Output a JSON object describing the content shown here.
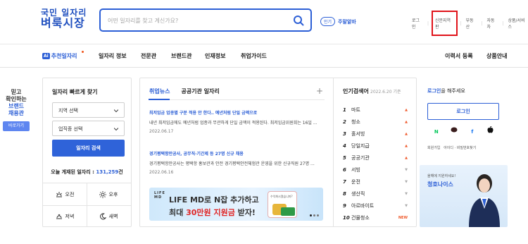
{
  "header": {
    "logo_line1": "국민 일자리",
    "logo_line2": "벼룩시장",
    "search_placeholder": "어떤 일자리를 찾고 계신가요?",
    "popular_pill": "인기",
    "popular_word": "주말알바",
    "util_links": [
      "로그인",
      "신문지역판",
      "부동산",
      "자동차",
      "상품/서비스"
    ]
  },
  "nav": {
    "ai_badge": "Ai",
    "ai_label": "추천일자리",
    "items": [
      "일자리 정보",
      "전문관",
      "브랜드관",
      "인재정보",
      "취업가이드"
    ],
    "right_items": [
      "이력서 등록",
      "상품안내"
    ]
  },
  "quick": {
    "line1": "믿고",
    "line2": "확인하는",
    "line3": "브랜드",
    "line4": "채용관",
    "button": "바로가기"
  },
  "job_search": {
    "title": "일자리 빠르게 찾기",
    "region_select": "지역 선택",
    "job_select": "업직종 선택",
    "search_button": "일자리 검색",
    "count_label": "오늘 게재된 일자리 :",
    "count_value": "131,259",
    "count_unit": "건",
    "times": [
      "오전",
      "오후",
      "저녁",
      "새벽"
    ]
  },
  "news": {
    "tabs": [
      "취업뉴스",
      "공공기관 일자리"
    ],
    "plus": "+",
    "items": [
      {
        "title": "최저임금 업종별 구분 적용 안 한다‥ 예년처럼 단일 금액으로",
        "body": "내년 최저임금에도 예년처럼 업종과 무관하게 단일 금액이 적용된다. 최저임금위원회는 16일 ...",
        "date": "2022.06.17"
      },
      {
        "title": "경기평택항만공사, 공무직·기간제 등 27명 신규 채용",
        "body": "경기평택항만공사는 평택항 홍보관과 안전 경기평택안전체험관 운영을 위한 신규직원 27명 ...",
        "date": "2022.06.16"
      }
    ],
    "ad": {
      "brand1": "LIFE",
      "brand2": "MD",
      "line1": "LIFE MD로 N잡 추가하고",
      "line2_pre": "최대 ",
      "line2_red": "30만원 지원금",
      "line2_post": " 받자!",
      "phone_text": "수익화시켰습니까?"
    }
  },
  "keywords": {
    "title": "인기검색어",
    "date": "2022.6.20 기준",
    "items": [
      {
        "rank": "1",
        "word": "마트",
        "trend": "up"
      },
      {
        "rank": "2",
        "word": "청소",
        "trend": "up"
      },
      {
        "rank": "3",
        "word": "홀서빙",
        "trend": "up"
      },
      {
        "rank": "4",
        "word": "당일지급",
        "trend": "up"
      },
      {
        "rank": "5",
        "word": "공공기관",
        "trend": "up"
      },
      {
        "rank": "6",
        "word": "서빙",
        "trend": "down"
      },
      {
        "rank": "7",
        "word": "운전",
        "trend": "down"
      },
      {
        "rank": "8",
        "word": "생산직",
        "trend": "down"
      },
      {
        "rank": "9",
        "word": "아르바이트",
        "trend": "down"
      },
      {
        "rank": "10",
        "word": "건물청소",
        "trend": "new"
      }
    ],
    "trend_symbols": {
      "up": "▲",
      "down": "▼",
      "new": "NEW"
    }
  },
  "login": {
    "headline_b": "로그인",
    "headline_rest": "을 해주세요",
    "button": "로그인",
    "social": [
      "N",
      "💬",
      "f",
      ""
    ],
    "links": [
      "회원가입",
      "아이디 · 비밀번호찾기"
    ]
  },
  "banner": {
    "small": "올해에 지원하세요!",
    "big": "청호나이스"
  },
  "colors": {
    "brand": "#1f4fbf",
    "accent": "#2c5fd6",
    "highlight_box": "#e0131a",
    "up": "#ef5a2c"
  }
}
